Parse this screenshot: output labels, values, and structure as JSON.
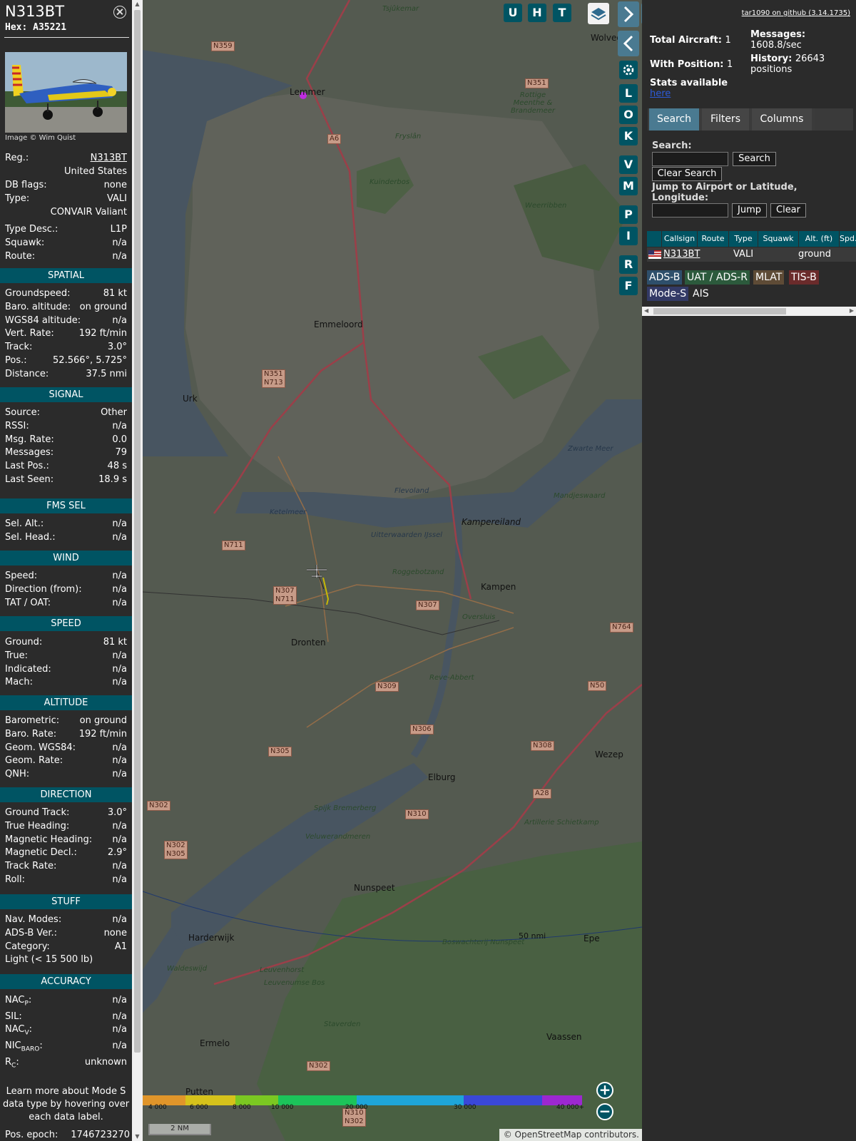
{
  "aircraft": {
    "callsign": "N313BT",
    "hex": "Hex: A35221",
    "photo_credit": "Image © Wim Quist",
    "reg_label": "Reg.:",
    "reg": "N313BT",
    "country": "United States",
    "dbflags_label": "DB flags:",
    "dbflags": "none",
    "type_label": "Type:",
    "type": "VALI",
    "type_name": "CONVAIR Valiant",
    "typedesc_label": "Type Desc.:",
    "typedesc": "L1P",
    "squawk_label": "Squawk:",
    "squawk": "n/a",
    "route_label": "Route:",
    "route": "n/a"
  },
  "sections": {
    "spatial": "SPATIAL",
    "signal": "SIGNAL",
    "fms": "FMS SEL",
    "wind": "WIND",
    "speed": "SPEED",
    "altitude": "ALTITUDE",
    "direction": "DIRECTION",
    "stuff": "STUFF",
    "accuracy": "ACCURACY"
  },
  "spatial": [
    {
      "k": "Groundspeed:",
      "v": "81 kt"
    },
    {
      "k": "Baro. altitude:",
      "v": "on ground"
    },
    {
      "k": "WGS84 altitude:",
      "v": "n/a"
    },
    {
      "k": "Vert. Rate:",
      "v": "192 ft/min"
    },
    {
      "k": "Track:",
      "v": "3.0°"
    },
    {
      "k": "Pos.:",
      "v": "52.566°, 5.725°"
    },
    {
      "k": "Distance:",
      "v": "37.5 nmi"
    }
  ],
  "signal": [
    {
      "k": "Source:",
      "v": "Other"
    },
    {
      "k": "RSSI:",
      "v": "n/a"
    },
    {
      "k": "Msg. Rate:",
      "v": "0.0"
    },
    {
      "k": "Messages:",
      "v": "79"
    },
    {
      "k": "Last Pos.:",
      "v": "48 s"
    },
    {
      "k": "Last Seen:",
      "v": "18.9 s"
    }
  ],
  "fms": [
    {
      "k": "Sel. Alt.:",
      "v": "n/a"
    },
    {
      "k": "Sel. Head.:",
      "v": "n/a"
    }
  ],
  "wind": [
    {
      "k": "Speed:",
      "v": "n/a"
    },
    {
      "k": "Direction (from):",
      "v": "n/a"
    },
    {
      "k": "TAT / OAT:",
      "v": "n/a"
    }
  ],
  "speed": [
    {
      "k": "Ground:",
      "v": "81 kt"
    },
    {
      "k": "True:",
      "v": "n/a"
    },
    {
      "k": "Indicated:",
      "v": "n/a"
    },
    {
      "k": "Mach:",
      "v": "n/a"
    }
  ],
  "altitude": [
    {
      "k": "Barometric:",
      "v": "on ground"
    },
    {
      "k": "Baro. Rate:",
      "v": "192 ft/min"
    },
    {
      "k": "Geom. WGS84:",
      "v": "n/a"
    },
    {
      "k": "Geom. Rate:",
      "v": "n/a"
    },
    {
      "k": "QNH:",
      "v": "n/a"
    }
  ],
  "direction": [
    {
      "k": "Ground Track:",
      "v": "3.0°"
    },
    {
      "k": "True Heading:",
      "v": "n/a"
    },
    {
      "k": "Magnetic Heading:",
      "v": "n/a"
    },
    {
      "k": "Magnetic Decl.:",
      "v": "2.9°"
    },
    {
      "k": "Track Rate:",
      "v": "n/a"
    },
    {
      "k": "Roll:",
      "v": "n/a"
    }
  ],
  "stuff": [
    {
      "k": "Nav. Modes:",
      "v": "n/a"
    },
    {
      "k": "ADS-B Ver.:",
      "v": "none"
    },
    {
      "k": "Category:",
      "v": "A1"
    },
    {
      "k": "Light (< 15 500 lb)",
      "v": ""
    }
  ],
  "accuracy": {
    "nacp_k": "NAC",
    "nacp_sub": "P",
    "nacp_v": "n/a",
    "sil_k": "SIL:",
    "sil_v": "n/a",
    "nacv_k": "NAC",
    "nacv_sub": "V",
    "nacv_v": "n/a",
    "nicbaro_k": "NIC",
    "nicbaro_sub": "BARO",
    "nicbaro_v": "n/a",
    "rc_k": "R",
    "rc_sub": "C",
    "rc_v": "unknown"
  },
  "learn_more": "Learn more about Mode S data type by hovering over each data label.",
  "pos_epoch_label": "Pos. epoch:",
  "pos_epoch": "1746723270",
  "map": {
    "buttons_top": [
      "U",
      "H",
      "T"
    ],
    "side_buttons": [
      "L",
      "O",
      "K",
      "V",
      "M",
      "P",
      "I",
      "R",
      "F"
    ],
    "range_ring_label": "50 nmi",
    "scale_label": "2 NM",
    "attribution": "© OpenStreetMap contributors.",
    "altitude_legend": [
      "4 000",
      "6 000",
      "8 000",
      "10 000",
      "20 000",
      "30 000",
      "40 000+"
    ],
    "places": [
      "Lemmer",
      "Emmeloord",
      "Urk",
      "Dronten",
      "Kampen",
      "Elburg",
      "Nunspeet",
      "Harderwijk",
      "Ermelo",
      "Putten",
      "Wezep",
      "Vaassen",
      "Epe",
      "Wolvega",
      "Kampereiland",
      "Artillerie Schietkamp",
      "Flevoland",
      "Ketelmeer",
      "Uitterwaarden IJssel",
      "Veluwerandmeren",
      "Weerribben",
      "Kuinderbos",
      "Zwarte Meer",
      "Mandjeswaard",
      "Roggebotzand",
      "Reve-Abbert",
      "Spijk Bremerberg",
      "Fryslân",
      "Rottige Meenthe & Brandemeer",
      "Tsjûkemar",
      "Leuvenhorst",
      "Leuvenumse Bos",
      "Staverden",
      "Boswachterij Nunspeet",
      "Waldeswijd",
      "Oversluis"
    ],
    "roads": [
      "N359",
      "N351",
      "A6",
      "N351 N713",
      "N711",
      "N307 N711",
      "N307",
      "N309",
      "N306",
      "N305",
      "N308",
      "N50",
      "A28",
      "N310",
      "N302",
      "N302 N305",
      "N764",
      "N302",
      "N310 N302"
    ]
  },
  "sidebar": {
    "version": "tar1090 on github (3.14.1735)",
    "total_aircraft_label": "Total Aircraft:",
    "total_aircraft": "1",
    "with_position_label": "With Position:",
    "with_position": "1",
    "messages_label": "Messages:",
    "messages": "1608.8/sec",
    "history_label": "History:",
    "history": "26643",
    "history_unit": "positions",
    "stats_label": "Stats available",
    "stats_link": "here",
    "tabs": [
      "Search",
      "Filters",
      "Columns"
    ],
    "search_label": "Search:",
    "search_button": "Search",
    "clear_search_button": "Clear Search",
    "jump_label": "Jump to Airport or Latitude, Longitude:",
    "jump_button": "Jump",
    "clear_button": "Clear",
    "columns": [
      "Callsign",
      "Route",
      "Type",
      "Squawk",
      "Alt. (ft)",
      "Spd."
    ],
    "row": {
      "callsign": "N313BT",
      "route": "",
      "type": "VALI",
      "squawk": "",
      "alt": "ground",
      "spd": ""
    },
    "sources": [
      "ADS-B",
      "UAT / ADS-R",
      "MLAT",
      "TIS-B",
      "Mode-S",
      "AIS"
    ]
  },
  "colors": {
    "accent": "#005463",
    "tab_active": "#4a7a91",
    "adsb": "#2e4f6b",
    "uat": "#2c5a3c",
    "mlat": "#5e4b36",
    "tisb": "#6b2b2b",
    "modes": "#333a66"
  }
}
